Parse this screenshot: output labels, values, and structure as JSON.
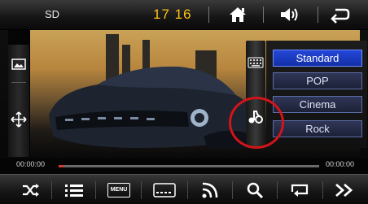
{
  "status": {
    "source": "SD",
    "time": "17 16"
  },
  "eq": {
    "presets": [
      "Standard",
      "POP",
      "Cinema",
      "Rock"
    ],
    "selected": "Standard"
  },
  "playback": {
    "elapsed": "00:00:00",
    "total": "00:00:00",
    "progress_fraction": 0.0
  },
  "colors": {
    "accent_time": "#ffc21a",
    "selected_preset": "#2446d8",
    "highlight_circle": "#d3141a"
  },
  "icons": {
    "top": [
      "home-icon",
      "volume-icon",
      "back-icon"
    ],
    "left_panel": [
      "image-icon",
      "move-icon"
    ],
    "rail": [
      "keyboard-icon",
      "audio-effect-icon"
    ],
    "bottom": [
      "shuffle-icon",
      "playlist-icon",
      "menu-icon",
      "subtitle-icon",
      "feed-icon",
      "search-icon",
      "repeat-icon",
      "next-icon"
    ]
  },
  "bottom_bar": {
    "menu_label": "MENU"
  }
}
